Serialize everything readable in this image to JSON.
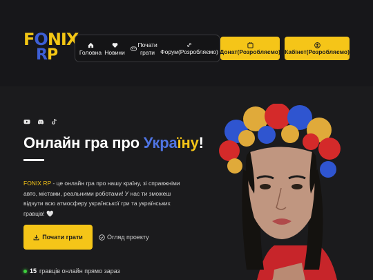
{
  "logo": {
    "line1_a": "F",
    "line1_o": "O",
    "line1_b": "NIX",
    "line2_r": "R",
    "line2_p": "P"
  },
  "nav": {
    "items": [
      {
        "label": "Головна",
        "icon": "home-icon"
      },
      {
        "label": "Новини",
        "icon": "heart-icon"
      },
      {
        "label": "Почати грати",
        "icon": "gamepad-icon"
      },
      {
        "label": "Форум(Розробляємо)",
        "icon": "link-icon"
      }
    ]
  },
  "header_buttons": {
    "donate": {
      "label": "Донат(Розробляємо)",
      "icon": "cart-icon"
    },
    "cabinet": {
      "label": "Кабінет(Розробляємо)",
      "icon": "user-icon"
    }
  },
  "socials": [
    "youtube-icon",
    "discord-icon",
    "tiktok-icon"
  ],
  "hero": {
    "title_prefix": "Онлайн гра про ",
    "title_blue": "Укра",
    "title_yellow": "їну",
    "title_suffix": "!",
    "desc_brand": "FONIX RP",
    "desc_text": " - це онлайн гра про нашу країну, зі справжніми авто, містами, реальними роботами! У нас ти зможеш відчути всю атмосферу української гри та українських гравців! 🤍"
  },
  "cta": {
    "label": "Почати грати",
    "icon": "download-icon"
  },
  "overview": {
    "label": "Огляд проекту",
    "icon": "check-circle-icon"
  },
  "online": {
    "count": "15",
    "text": "гравців онлайн прямо зараз"
  },
  "colors": {
    "accent": "#f5c518",
    "blue": "#4f74e3",
    "background": "#1b1b1d",
    "online": "#3ed13e"
  }
}
